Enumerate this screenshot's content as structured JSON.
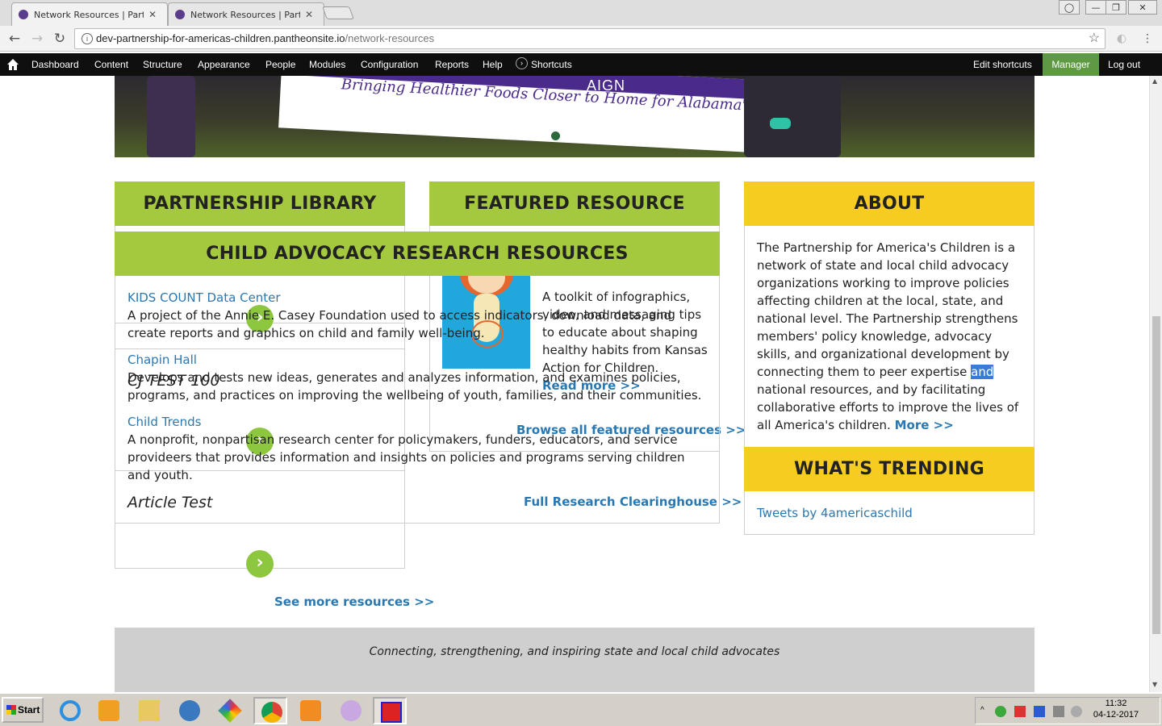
{
  "browser": {
    "tabs": [
      {
        "title": "Network Resources | Partne",
        "active": true
      },
      {
        "title": "Network Resources | Partne",
        "active": false
      }
    ],
    "url_host": "dev-partnership-for-americas-children.pantheonsite.io",
    "url_path": "/network-resources"
  },
  "admin_bar": {
    "items": [
      "Dashboard",
      "Content",
      "Structure",
      "Appearance",
      "People",
      "Modules",
      "Configuration",
      "Reports",
      "Help",
      "Shortcuts"
    ],
    "edit_shortcuts": "Edit shortcuts",
    "manager": "Manager",
    "logout": "Log out"
  },
  "hero": {
    "banner_text": "Bringing Healthier Foods Closer to Home for Alabama's Children",
    "banner_fragment": "AIGN",
    "slide_count": 3,
    "active_slide": 0
  },
  "library": {
    "title": "PARTNERSHIP LIBRARY",
    "hidden_item": "CJ TEST 100",
    "article": "Article Test",
    "see_more": "See more resources >>"
  },
  "featured": {
    "title": "FEATURED RESOURCE",
    "description": "A toolkit of infographics, video, and messaging tips to educate about shaping healthy habits from Kansas Action for Children.",
    "read_more": "Read more >>",
    "browse_all": "Browse all featured resources >>"
  },
  "research": {
    "title": "CHILD ADVOCACY RESEARCH RESOURCES",
    "items": [
      {
        "name": "KIDS COUNT Data Center",
        "desc": "A project of the Annie E. Casey Foundation used to access indicators, download data, and create reports and graphics on child and family well-being."
      },
      {
        "name": "Chapin Hall",
        "desc": "Develops and tests new ideas, generates and analyzes information, and examines policies, programs, and practices on improving the wellbeing of youth, families, and their communities."
      },
      {
        "name": "Child Trends",
        "desc": "A nonprofit, nonpartisan research center for policymakers, funders, educators, and service provideers that provides information and insights on policies and programs serving children and youth."
      }
    ],
    "clearinghouse": "Full Research Clearinghouse >>"
  },
  "about": {
    "title": "ABOUT",
    "text_before": "The Partnership for America's Children is a network of state and local child advocacy organizations working to improve policies affecting children at the local, state, and national level. The Partnership strengthens members' policy knowledge, advocacy skills, and organizational development by connecting them to peer expertise ",
    "selected_word": "and",
    "text_after": " national resources, and by facilitating collaborative efforts to improve the lives of all America's children.",
    "more": "More >>"
  },
  "trending": {
    "title": "WHAT'S TRENDING",
    "tweets": "Tweets by 4americaschild"
  },
  "footer": {
    "tagline": "Connecting, strengthening, and inspiring state and local child advocates"
  },
  "taskbar": {
    "start": "Start",
    "time": "11:32",
    "date": "04-12-2017"
  },
  "colors": {
    "green_header": "#a4c93f",
    "yellow_header": "#f5cc1f",
    "link": "#2a78b2",
    "admin_bar": "#0f0f0f",
    "manager": "#5d9a43"
  }
}
